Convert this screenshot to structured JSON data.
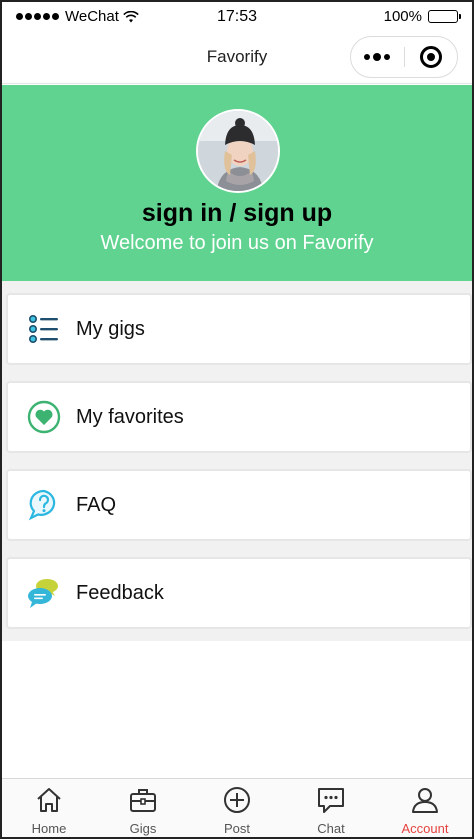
{
  "status_bar": {
    "carrier": "WeChat",
    "time": "17:53",
    "battery": "100%"
  },
  "nav": {
    "title": "Favorify"
  },
  "hero": {
    "title": "sign in / sign up",
    "subtitle": "Welcome to join us on Favorify"
  },
  "menu": {
    "items": [
      {
        "label": "My gigs",
        "icon": "list-icon"
      },
      {
        "label": "My favorites",
        "icon": "heart-icon"
      },
      {
        "label": "FAQ",
        "icon": "question-bubble-icon"
      },
      {
        "label": "Feedback",
        "icon": "chat-bubbles-icon"
      }
    ]
  },
  "tabbar": {
    "items": [
      {
        "label": "Home",
        "icon": "home-icon"
      },
      {
        "label": "Gigs",
        "icon": "briefcase-icon"
      },
      {
        "label": "Post",
        "icon": "plus-circle-icon"
      },
      {
        "label": "Chat",
        "icon": "chat-icon"
      },
      {
        "label": "Account",
        "icon": "person-icon",
        "active": true
      }
    ]
  },
  "colors": {
    "brand_green": "#5fd38f",
    "tab_active": "#e64340"
  }
}
